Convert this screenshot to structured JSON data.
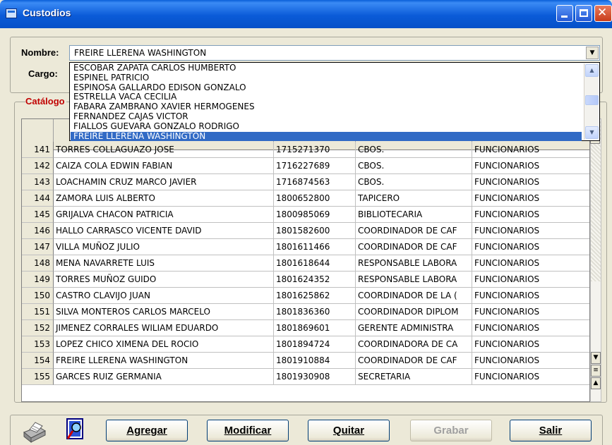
{
  "window": {
    "title": "Custodios"
  },
  "form": {
    "nombre_label": "Nombre:",
    "nombre_value": "FREIRE LLERENA WASHINGTON",
    "cargo_label": "Cargo:"
  },
  "dropdown": {
    "items": [
      "ESCOBAR ZAPATA CARLOS HUMBERTO",
      "ESPINEL PATRICIO",
      "ESPINOSA GALLARDO EDISON GONZALO",
      "ESTRELLA VACA CECILIA",
      "FABARA ZAMBRANO XAVIER HERMOGENES",
      "FERNANDEZ CAJAS VICTOR",
      "FIALLOS GUEVARA GONZALO RODRIGO",
      "FREIRE LLERENA WASHINGTON"
    ],
    "selected_index": 7
  },
  "catalog": {
    "group_label": "Catálogo",
    "rows": [
      {
        "num": "141",
        "name": "TORRES COLLAGUAZO JOSE",
        "ced": "1715271370",
        "cargo": "CBOS.",
        "tipo": "FUNCIONARIOS"
      },
      {
        "num": "142",
        "name": "CAIZA COLA EDWIN FABIAN",
        "ced": "1716227689",
        "cargo": "CBOS.",
        "tipo": "FUNCIONARIOS"
      },
      {
        "num": "143",
        "name": "LOACHAMIN CRUZ MARCO JAVIER",
        "ced": "1716874563",
        "cargo": "CBOS.",
        "tipo": "FUNCIONARIOS"
      },
      {
        "num": "144",
        "name": "ZAMORA LUIS ALBERTO",
        "ced": "1800652800",
        "cargo": "TAPICERO",
        "tipo": "FUNCIONARIOS"
      },
      {
        "num": "145",
        "name": "GRIJALVA CHACON PATRICIA",
        "ced": "1800985069",
        "cargo": "BIBLIOTECARIA",
        "tipo": "FUNCIONARIOS"
      },
      {
        "num": "146",
        "name": "HALLO CARRASCO VICENTE DAVID",
        "ced": "1801582600",
        "cargo": "COORDINADOR DE CAF",
        "tipo": "FUNCIONARIOS"
      },
      {
        "num": "147",
        "name": "VILLA MUÑOZ JULIO",
        "ced": "1801611466",
        "cargo": "COORDINADOR DE CAF",
        "tipo": "FUNCIONARIOS"
      },
      {
        "num": "148",
        "name": "MENA NAVARRETE LUIS",
        "ced": "1801618644",
        "cargo": "RESPONSABLE LABORA",
        "tipo": "FUNCIONARIOS"
      },
      {
        "num": "149",
        "name": "TORRES MUÑOZ GUIDO",
        "ced": "1801624352",
        "cargo": "RESPONSABLE LABORA",
        "tipo": "FUNCIONARIOS"
      },
      {
        "num": "150",
        "name": "CASTRO CLAVIJO JUAN",
        "ced": "1801625862",
        "cargo": "COORDINADOR DE LA (",
        "tipo": "FUNCIONARIOS"
      },
      {
        "num": "151",
        "name": "SILVA MONTEROS CARLOS MARCELO",
        "ced": "1801836360",
        "cargo": "COORDINADOR DIPLOM",
        "tipo": "FUNCIONARIOS"
      },
      {
        "num": "152",
        "name": "JIMENEZ CORRALES WILIAM EDUARDO",
        "ced": "1801869601",
        "cargo": "GERENTE ADMINISTRA",
        "tipo": "FUNCIONARIOS"
      },
      {
        "num": "153",
        "name": "LOPEZ CHICO XIMENA DEL ROCIO",
        "ced": "1801894724",
        "cargo": "COORDINADORA DE CA",
        "tipo": "FUNCIONARIOS"
      },
      {
        "num": "154",
        "name": "FREIRE LLERENA WASHINGTON",
        "ced": "1801910884",
        "cargo": "COORDINADOR DE CAF",
        "tipo": "FUNCIONARIOS"
      },
      {
        "num": "155",
        "name": "GARCES RUIZ GERMANIA",
        "ced": "1801930908",
        "cargo": "SECRETARIA",
        "tipo": "FUNCIONARIOS"
      }
    ]
  },
  "buttons": {
    "agregar": "Agregar",
    "modificar": "Modificar",
    "quitar": "Quitar",
    "grabar": "Grabar",
    "salir": "Salir"
  },
  "icons": {
    "print": "printer-icon",
    "preview": "print-preview-icon"
  }
}
